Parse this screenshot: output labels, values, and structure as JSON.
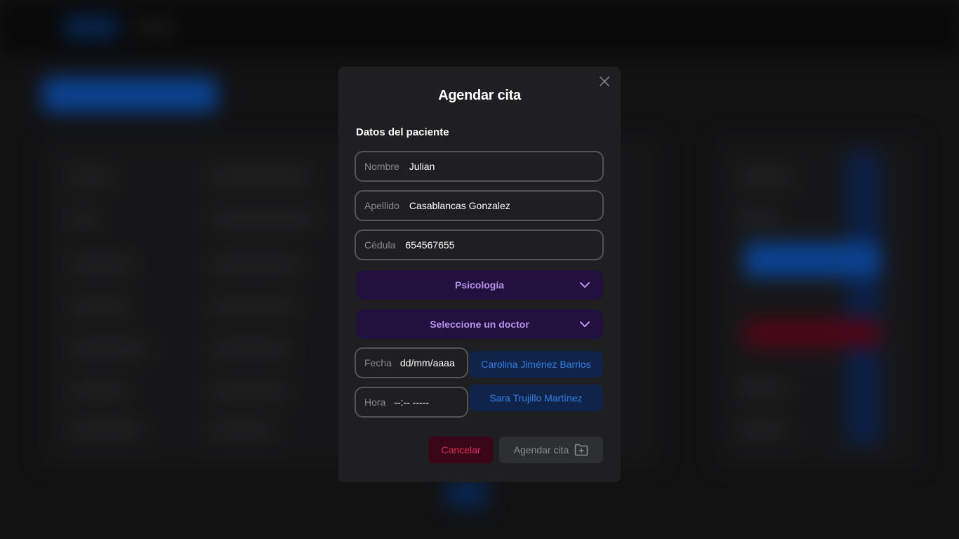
{
  "modal": {
    "title": "Agendar cita",
    "section_title": "Datos del paciente",
    "fields": {
      "nombre": {
        "label": "Nombre",
        "value": "Julian"
      },
      "apellido": {
        "label": "Apellido",
        "value": "Casablancas Gonzalez"
      },
      "cedula": {
        "label": "Cédula",
        "value": "654567655"
      },
      "fecha": {
        "label": "Fecha",
        "value": "dd/mm/aaaa"
      },
      "hora": {
        "label": "Hora",
        "value": "--:-- -----"
      }
    },
    "specialty_select": {
      "selected": "Psicología"
    },
    "doctor_select": {
      "selected": "Seleccione un doctor"
    },
    "doctor_options": [
      "Carolina Jiménez Barrios",
      "Sara Trujillo Martínez"
    ],
    "cancel_label": "Cancelar",
    "submit_label": "Agendar cita",
    "icons": {
      "close": "close-icon",
      "chevron": "chevron-down-icon",
      "submit": "folder-plus-icon"
    }
  },
  "colors": {
    "modal_bg": "#1f1f21",
    "select_bg": "#22103f",
    "select_text": "#b793ec",
    "doctor_bg": "#10244a",
    "doctor_text": "#2f7fe6",
    "cancel_bg": "#3a0718",
    "cancel_text": "#e0295a",
    "submit_bg": "#2d2f31",
    "submit_text": "#8a8c8f"
  }
}
